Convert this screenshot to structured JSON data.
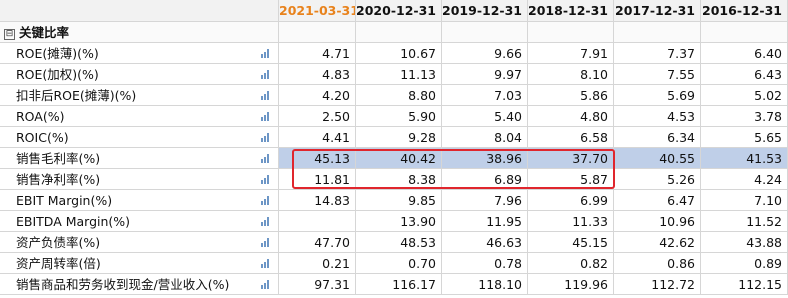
{
  "header": {
    "blank": "",
    "periods": [
      "2021-03-31",
      "2020-12-31",
      "2019-12-31",
      "2018-12-31",
      "2017-12-31",
      "2016-12-31"
    ]
  },
  "section": {
    "toggle": "⊟",
    "title": "关键比率"
  },
  "rows": [
    {
      "label": "ROE(摊薄)(%)",
      "values": [
        "4.71",
        "10.67",
        "9.66",
        "7.91",
        "7.37",
        "6.40"
      ]
    },
    {
      "label": "ROE(加权)(%)",
      "values": [
        "4.83",
        "11.13",
        "9.97",
        "8.10",
        "7.55",
        "6.43"
      ]
    },
    {
      "label": "扣非后ROE(摊薄)(%)",
      "values": [
        "4.20",
        "8.80",
        "7.03",
        "5.86",
        "5.69",
        "5.02"
      ]
    },
    {
      "label": "ROA(%)",
      "values": [
        "2.50",
        "5.90",
        "5.40",
        "4.80",
        "4.53",
        "3.78"
      ]
    },
    {
      "label": "ROIC(%)",
      "values": [
        "4.41",
        "9.28",
        "8.04",
        "6.58",
        "6.34",
        "5.65"
      ]
    },
    {
      "label": "销售毛利率(%)",
      "values": [
        "45.13",
        "40.42",
        "38.96",
        "37.70",
        "40.55",
        "41.53"
      ]
    },
    {
      "label": "销售净利率(%)",
      "values": [
        "11.81",
        "8.38",
        "6.89",
        "5.87",
        "5.26",
        "4.24"
      ]
    },
    {
      "label": "EBIT Margin(%)",
      "values": [
        "14.83",
        "9.85",
        "7.96",
        "6.99",
        "6.47",
        "7.10"
      ]
    },
    {
      "label": "EBITDA Margin(%)",
      "values": [
        "",
        "13.90",
        "11.95",
        "11.33",
        "10.96",
        "11.52"
      ]
    },
    {
      "label": "资产负债率(%)",
      "values": [
        "47.70",
        "48.53",
        "46.63",
        "45.15",
        "42.62",
        "43.88"
      ]
    },
    {
      "label": "资产周转率(倍)",
      "values": [
        "0.21",
        "0.70",
        "0.78",
        "0.82",
        "0.86",
        "0.89"
      ]
    },
    {
      "label": "销售商品和劳务收到现金/营业收入(%)",
      "values": [
        "97.31",
        "116.17",
        "118.10",
        "119.96",
        "112.72",
        "112.15"
      ]
    }
  ],
  "colors": {
    "accent": "#e8821c",
    "highlight": "#bfcfe8",
    "box": "#e0262d"
  },
  "icons": {
    "row_chart": "bar-chart-icon",
    "section_toggle": "collapse-toggle-icon"
  }
}
